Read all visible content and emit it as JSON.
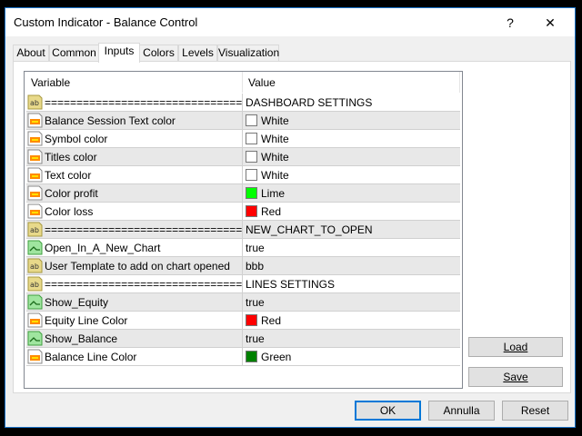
{
  "window": {
    "title": "Custom Indicator - Balance Control",
    "help_label": "?",
    "close_label": "✕"
  },
  "tabs": [
    {
      "label": "About"
    },
    {
      "label": "Common"
    },
    {
      "label": "Inputs",
      "active": true
    },
    {
      "label": "Colors"
    },
    {
      "label": "Levels"
    },
    {
      "label": "Visualization"
    }
  ],
  "table": {
    "headers": [
      "Variable",
      "Value"
    ],
    "rows": [
      {
        "icon": "text-param-icon",
        "variable": "===============================",
        "value": "DASHBOARD SETTINGS"
      },
      {
        "icon": "color-param-icon",
        "variable": "Balance Session Text color",
        "value": "White",
        "swatch": "#ffffff"
      },
      {
        "icon": "color-param-icon",
        "variable": "Symbol color",
        "value": "White",
        "swatch": "#ffffff"
      },
      {
        "icon": "color-param-icon",
        "variable": "Titles color",
        "value": "White",
        "swatch": "#ffffff"
      },
      {
        "icon": "color-param-icon",
        "variable": "Text color",
        "value": "White",
        "swatch": "#ffffff"
      },
      {
        "icon": "color-param-icon",
        "variable": "Color profit",
        "value": "Lime",
        "swatch": "#00ff00"
      },
      {
        "icon": "color-param-icon",
        "variable": "Color loss",
        "value": "Red",
        "swatch": "#ff0000"
      },
      {
        "icon": "text-param-icon",
        "variable": "===============================",
        "value": "NEW_CHART_TO_OPEN"
      },
      {
        "icon": "bool-param-icon",
        "variable": "Open_In_A_New_Chart",
        "value": "true"
      },
      {
        "icon": "text-param-icon",
        "variable": "User Template to add on chart opened",
        "value": "bbb"
      },
      {
        "icon": "text-param-icon",
        "variable": "===============================",
        "value": "LINES SETTINGS"
      },
      {
        "icon": "bool-param-icon",
        "variable": "Show_Equity",
        "value": "true"
      },
      {
        "icon": "color-param-icon",
        "variable": "Equity Line Color",
        "value": "Red",
        "swatch": "#ff0000"
      },
      {
        "icon": "bool-param-icon",
        "variable": "Show_Balance",
        "value": "true"
      },
      {
        "icon": "color-param-icon",
        "variable": "Balance Line Color",
        "value": "Green",
        "swatch": "#008000"
      }
    ]
  },
  "buttons": {
    "load": "Load",
    "save": "Save",
    "ok": "OK",
    "cancel": "Annulla",
    "reset": "Reset"
  }
}
